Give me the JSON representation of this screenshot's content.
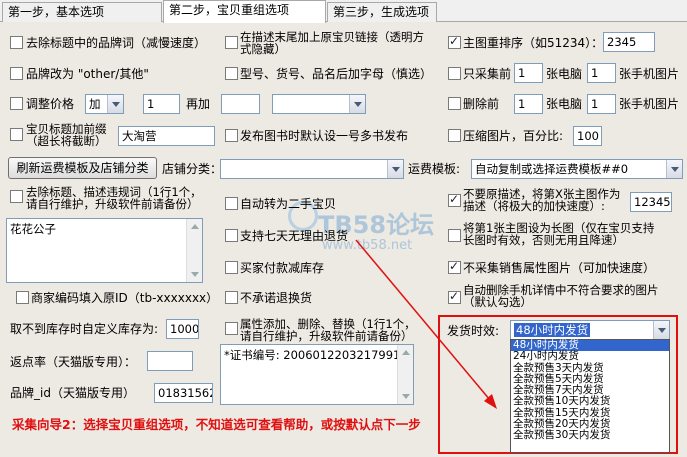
{
  "tabs": [
    "第一步，基本选项",
    "第二步，宝贝重组选项",
    "第三步，生成选项"
  ],
  "col1": {
    "remove_brand": "去除标题中的品牌词（减慢速度）",
    "brand_change": "品牌改为 \"other/其他\"",
    "adjust_price": "调整价格",
    "price_op": "加",
    "price_value": "1",
    "price_add_label": "再加",
    "price_add_value": "",
    "prefix_line1": "宝贝标题加前缀",
    "prefix_line2": "（超长将截断）",
    "prefix_value": "大淘营",
    "refresh_button": "刷新运费模板及店铺分类",
    "shop_category_label": "店铺分类：",
    "remove_forbidden_line1": "去除标题、描述违规词（1行1个，",
    "remove_forbidden_line2": "请自行维护，升级软件前请备份）",
    "forbidden_words": "花花公子",
    "merchant_code": "商家编码填入原ID（tb-xxxxxxx）",
    "stock_label": "取不到库存时自定义库存为:",
    "stock_value": "1000",
    "rebate_label": "返点率（天猫版专用）：",
    "rebate_value": "",
    "brand_id_label": "品牌_id（天猫版专用）",
    "brand_id_value": "018315629"
  },
  "col2": {
    "add_link_line1": "在描述末尾加上原宝贝链接（透明方",
    "add_link_line2": "式隐藏）",
    "model_suffix": "型号、货号、品名后加字母（慎选）",
    "publish_default": "发布图书时默认设一号多书发布",
    "auto_secondhand": "自动转为二手宝贝",
    "support_7day": "支持七天无理由退货",
    "buyer_pay_stock": "买家付款减库存",
    "no_refund": "不承诺退换货",
    "attr_line1": "属性添加、删除、替换（1行1个，",
    "attr_line2": "请自行维护，升级软件前请备份）",
    "attr_text": "*证书编号: 2006012203217991"
  },
  "col3": {
    "main_image_sort": "主图重排序（如51234）：",
    "main_image_sort_value": "2345",
    "only_collect": "只采集前",
    "only_collect_pc": "1",
    "only_collect_pc_label": "张电脑",
    "only_collect_mobile": "1",
    "only_collect_mobile_label": "张手机图片",
    "delete_front": "删除前",
    "delete_pc": "1",
    "delete_pc_label": "张电脑",
    "delete_mobile": "1",
    "delete_mobile_label": "张手机图片",
    "compress": "压缩图片，百分比:",
    "compress_value": "100",
    "shipping_template_label": "运费模板:",
    "shipping_template_value": "自动复制或选择运费模板##0",
    "no_desc_line1": "不要原描述，将第X张主图作为",
    "no_desc_line2": "描述（将极大的加快速度）:",
    "no_desc_value": "12345",
    "long_image_line1": "将第1张主图设为长图（仅在宝贝支持",
    "long_image_line2": "长图时有效，否则无用且降速）",
    "no_sale_attr": "不采集销售属性图片（可加快速度）",
    "auto_delete_line1": "自动删除手机详情中不符合要求的图片",
    "auto_delete_line2": "（默认勾选）"
  },
  "delivery": {
    "label": "发货时效:",
    "selected": "48小时内发货",
    "options": [
      "48小时内发货",
      "24小时内发货",
      "全款预售3天内发货",
      "全款预售5天内发货",
      "全款预售7天内发货",
      "全款预售10天内发货",
      "全款预售15天内发货",
      "全款预售20天内发货",
      "全款预售30天内发货"
    ]
  },
  "guide_text": "采集向导2：选择宝贝重组选项，不知道选可查看帮助，或按默认点下一步",
  "watermark": {
    "line1": "TB58论坛",
    "line2": "www.tb58.net"
  },
  "colors": {
    "accent_red": "#e01010",
    "selection_blue": "#3366cc"
  }
}
